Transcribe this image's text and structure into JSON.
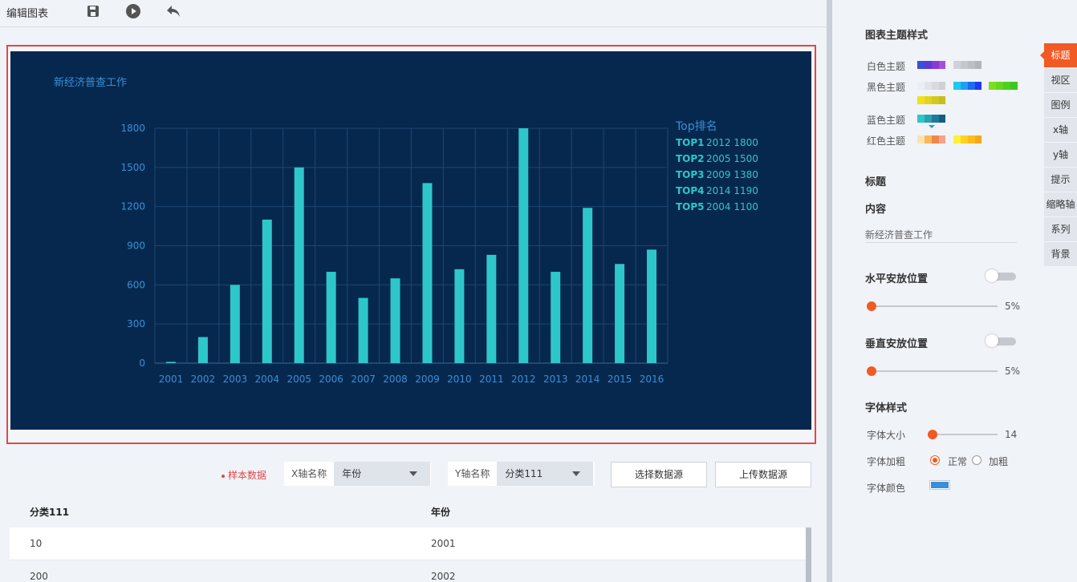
{
  "toolbar": {
    "title": "编辑图表",
    "icons": [
      "save-icon",
      "play-icon",
      "undo-icon"
    ]
  },
  "chart_data": {
    "type": "bar",
    "title": "新经济普查工作",
    "categories": [
      "2001",
      "2002",
      "2003",
      "2004",
      "2005",
      "2006",
      "2007",
      "2008",
      "2009",
      "2010",
      "2011",
      "2012",
      "2013",
      "2014",
      "2015",
      "2016"
    ],
    "series": [
      {
        "values": [
          10,
          200,
          600,
          1100,
          1500,
          700,
          500,
          650,
          1380,
          720,
          830,
          1800,
          700,
          1190,
          760,
          870
        ]
      }
    ],
    "ylim": [
      0,
      1800
    ],
    "yticks": [
      "0",
      "300",
      "600",
      "900",
      "1200",
      "1500",
      "1800"
    ],
    "grid": true,
    "bar_color": "#2ec7c9",
    "background": "#07284e",
    "ranking": {
      "title": "Top排名",
      "items": [
        {
          "label": "TOP1",
          "text": "2012 1800"
        },
        {
          "label": "TOP2",
          "text": "2005 1500"
        },
        {
          "label": "TOP3",
          "text": "2009 1380"
        },
        {
          "label": "TOP4",
          "text": "2014 1190"
        },
        {
          "label": "TOP5",
          "text": "2004 1100"
        }
      ]
    }
  },
  "controls": {
    "sample": "样本数据",
    "x_label": "X轴名称",
    "x_value": "年份",
    "y_label": "Y轴名称",
    "y_value": "分类111",
    "select_source": "选择数据源",
    "upload_source": "上传数据源"
  },
  "table": {
    "headers": [
      "分类111",
      "年份"
    ],
    "rows": [
      [
        "10",
        "2001"
      ],
      [
        "200",
        "2002"
      ]
    ]
  },
  "panel": {
    "theme_title": "图表主题样式",
    "themes": {
      "white": "白色主题",
      "black": "黑色主题",
      "blue": "蓝色主题",
      "red": "红色主题"
    },
    "title_section": "标题",
    "content_label": "内容",
    "content_value": "新经济普查工作",
    "h_pos": "水平安放位置",
    "h_pos_value": "5%",
    "v_pos": "垂直安放位置",
    "v_pos_value": "5%",
    "font_style": "字体样式",
    "font_size_label": "字体大小",
    "font_size_value": "14",
    "font_weight_label": "字体加粗",
    "weight_normal": "正常",
    "weight_bold": "加粗",
    "font_color_label": "字体颜色",
    "font_color": "#3a8fd6"
  },
  "tabs": [
    "标题",
    "视区",
    "图例",
    "x轴",
    "y轴",
    "提示",
    "缩略轴",
    "系列",
    "背景"
  ],
  "colors": {
    "accent": "#f15a24",
    "frame_border": "#e04848"
  }
}
